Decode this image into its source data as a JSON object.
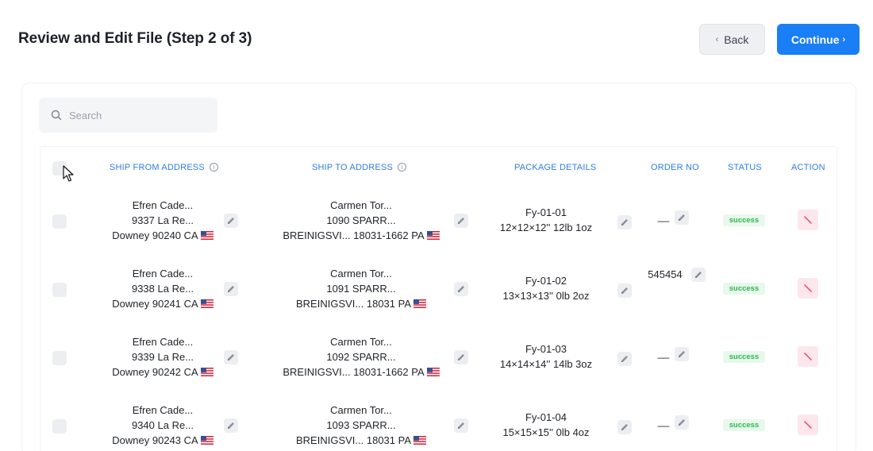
{
  "header": {
    "title": "Review and Edit File (Step 2 of 3)",
    "back_label": "Back",
    "continue_label": "Continue"
  },
  "search": {
    "placeholder": "Search"
  },
  "table": {
    "columns": {
      "ship_from": "SHIP FROM ADDRESS",
      "ship_to": "SHIP TO ADDRESS",
      "package": "PACKAGE DETAILS",
      "order_no": "ORDER NO",
      "status": "STATUS",
      "action": "ACTION"
    },
    "rows": [
      {
        "from_name": "Efren Cade...",
        "from_street": "9337 La Re...",
        "from_city": "Downey 90240 CA",
        "to_name": "Carmen Tor...",
        "to_street": "1090 SPARR...",
        "to_city": "BREINIGSVI... 18031-1662 PA",
        "pkg_id": "Fy-01-01",
        "pkg_dims": "12×12×12'' 12lb 1oz",
        "order_no": "__",
        "status": "success"
      },
      {
        "from_name": "Efren Cade...",
        "from_street": "9338 La Re...",
        "from_city": "Downey 90241 CA",
        "to_name": "Carmen Tor...",
        "to_street": "1091 SPARR...",
        "to_city": "BREINIGSVI... 18031 PA",
        "pkg_id": "Fy-01-02",
        "pkg_dims": "13×13×13'' 0lb 2oz",
        "order_no": "545454",
        "status": "success"
      },
      {
        "from_name": "Efren Cade...",
        "from_street": "9339 La Re...",
        "from_city": "Downey 90242 CA",
        "to_name": "Carmen Tor...",
        "to_street": "1092 SPARR...",
        "to_city": "BREINIGSVI... 18031-1662 PA",
        "pkg_id": "Fy-01-03",
        "pkg_dims": "14×14×14'' 14lb 3oz",
        "order_no": "__",
        "status": "success"
      },
      {
        "from_name": "Efren Cade...",
        "from_street": "9340 La Re...",
        "from_city": "Downey 90243 CA",
        "to_name": "Carmen Tor...",
        "to_street": "1093 SPARR...",
        "to_city": "BREINIGSVI... 18031 PA",
        "pkg_id": "Fy-01-04",
        "pkg_dims": "15×15×15'' 0lb 4oz",
        "order_no": "__",
        "status": "success"
      }
    ]
  },
  "icons": {
    "search": "search-icon",
    "info": "info-icon",
    "edit": "pencil-icon",
    "delete": "slash-delete-icon",
    "flag": "us-flag-icon",
    "cursor": "mouse-pointer-icon"
  },
  "colors": {
    "accent": "#1a7ef5",
    "header_text": "#2f7ee0",
    "success_bg": "#e8f8ec",
    "success_text": "#2eb84f",
    "delete_bg": "#fde7ec",
    "delete_icon": "#e8456b"
  }
}
